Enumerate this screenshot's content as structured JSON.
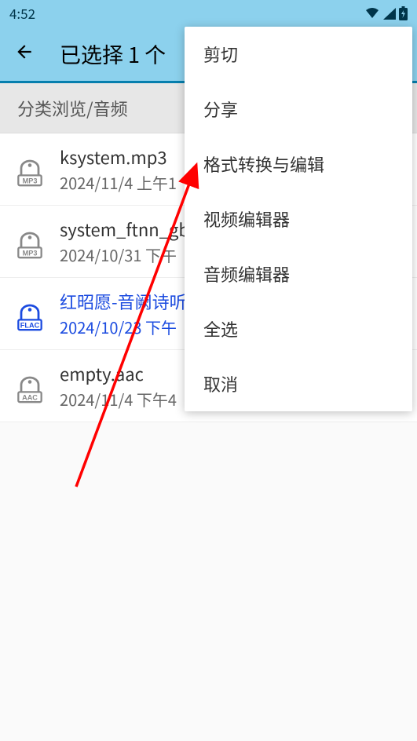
{
  "status": {
    "time": "4:52"
  },
  "header": {
    "title": "已选择 1 个"
  },
  "category": {
    "label": "分类浏览/音频"
  },
  "files": [
    {
      "name": "ksystem.mp3",
      "date": "2024/11/4 上午1",
      "ext": "MP3",
      "selected": false
    },
    {
      "name": "system_ftnn_gb",
      "date": "2024/10/31 下午",
      "ext": "MP3",
      "selected": false
    },
    {
      "name": "红昭愿-音阙诗听",
      "date": "2024/10/23 下午",
      "ext": "FLAC",
      "selected": true
    },
    {
      "name": "empty.aac",
      "date": "2024/11/4 下午4",
      "ext": "AAC",
      "selected": false
    }
  ],
  "menu": {
    "items": [
      "剪切",
      "分享",
      "格式转换与编辑",
      "视频编辑器",
      "音频编辑器",
      "全选",
      "取消"
    ]
  }
}
